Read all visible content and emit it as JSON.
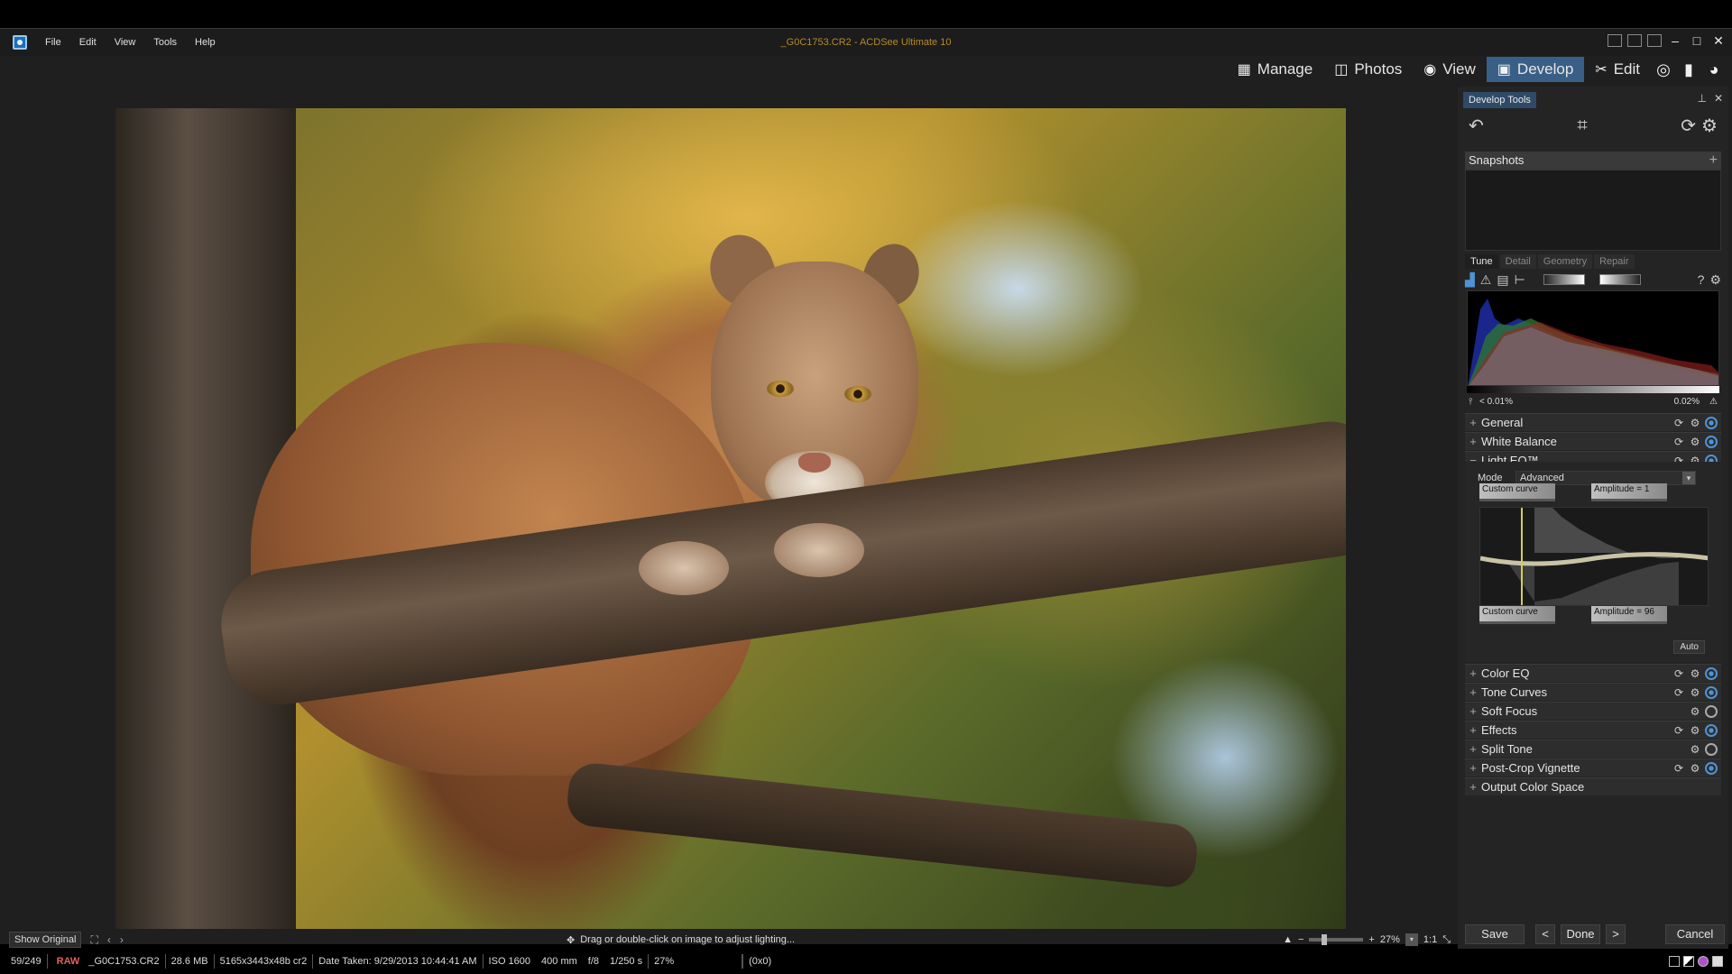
{
  "window": {
    "title": "_G0C1753.CR2 - ACDSee Ultimate 10",
    "menu": [
      "File",
      "Edit",
      "View",
      "Tools",
      "Help"
    ],
    "controls": {
      "minimize": "–",
      "maximize": "□",
      "close": "✕"
    }
  },
  "modes": [
    {
      "label": "Manage",
      "icon": "grid-icon"
    },
    {
      "label": "Photos",
      "icon": "photos-icon"
    },
    {
      "label": "View",
      "icon": "eye-icon"
    },
    {
      "label": "Develop",
      "icon": "develop-icon",
      "active": true
    },
    {
      "label": "Edit",
      "icon": "edit-icon"
    }
  ],
  "extra_mode_icons": [
    "365-icon",
    "dashboard-icon",
    "online-eye-icon"
  ],
  "image": {
    "subject": "Mountain lion crouched on a pine branch"
  },
  "image_toolbar": {
    "show_original": "Show Original",
    "hint": "Drag or double-click on image to adjust lighting...",
    "zoom": "27%",
    "one_to_one": "1:1"
  },
  "status": {
    "index": "59/249",
    "format": "RAW",
    "filename": "_G0C1753.CR2",
    "size": "28.6 MB",
    "dimensions": "5165x3443x48b cr2",
    "date": "Date Taken: 9/29/2013 10:44:41 AM",
    "iso": "ISO 1600",
    "focal": "400 mm",
    "aperture": "f/8",
    "shutter": "1/250 s",
    "zoom": "27%",
    "coords": "(0x0)"
  },
  "panel": {
    "tab": "Develop Tools",
    "snapshots": "Snapshots",
    "subtabs": [
      "Tune",
      "Detail",
      "Geometry",
      "Repair"
    ],
    "clip_low": "< 0.01%",
    "clip_high": "0.02%",
    "sections_top": [
      {
        "label": "General",
        "state": "on"
      },
      {
        "label": "White Balance",
        "state": "on"
      }
    ],
    "lighteq": {
      "label": "Light EQ™",
      "mode_label": "Mode",
      "mode_value": "Advanced",
      "top_left": "Custom curve",
      "top_right": "Amplitude = 1",
      "bottom_left": "Custom curve",
      "bottom_right": "Amplitude = 96",
      "auto": "Auto"
    },
    "sections_bottom": [
      {
        "label": "Color EQ",
        "state": "on",
        "reset": true
      },
      {
        "label": "Tone Curves",
        "state": "on",
        "reset": true
      },
      {
        "label": "Soft Focus",
        "state": "off",
        "reset": false
      },
      {
        "label": "Effects",
        "state": "on",
        "reset": true
      },
      {
        "label": "Split Tone",
        "state": "off",
        "reset": false
      },
      {
        "label": "Post-Crop Vignette",
        "state": "on",
        "reset": true
      },
      {
        "label": "Output Color Space",
        "state": "none",
        "reset": false
      }
    ],
    "buttons": {
      "save": "Save",
      "prev": "<",
      "done": "Done",
      "next": ">",
      "cancel": "Cancel"
    }
  },
  "colors": {
    "accent": "#3a5f86",
    "raw": "#e26060",
    "toggle_on": "#4f93d4"
  }
}
